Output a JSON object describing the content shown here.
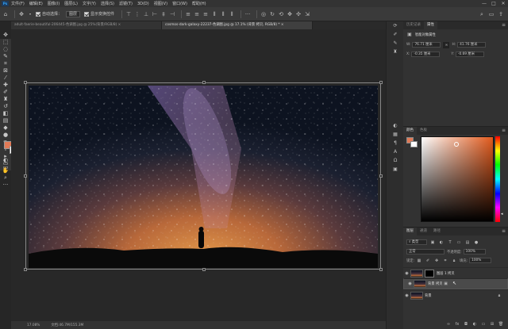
{
  "app": {
    "logo": "Ps"
  },
  "menu": [
    "文件(F)",
    "编辑(E)",
    "图像(I)",
    "图层(L)",
    "文字(Y)",
    "选择(S)",
    "滤镜(T)",
    "3D(D)",
    "视图(V)",
    "窗口(W)",
    "帮助(H)"
  ],
  "window_controls": [
    "—",
    "□",
    "✕"
  ],
  "options": {
    "auto_select_label": "自动选择：",
    "auto_select_value": "图层",
    "show_transform_label": "显示变换控件"
  },
  "tabs": [
    {
      "label": "adult-faerie-beautiful-206445-色调图.jpg @ 25%(背景/RGB/8) ×"
    },
    {
      "label": "cosmos-dark-galaxy-22237-色调图.jpg @ 17.1% (背景 拷贝, RGB/8) * ×"
    }
  ],
  "status": {
    "zoom": "17.08%",
    "doc": "文档:46.7M/155.3M"
  },
  "properties": {
    "tabs": [
      "历史记录",
      "属性"
    ],
    "title": "智能对象属性",
    "w_label": "W:",
    "w_value": "76.71 厘米",
    "h_label": "H:",
    "h_value": "41.76 厘米",
    "x_label": "X:",
    "x_value": "-0.35 厘米",
    "y_label": "Y:",
    "y_value": "-0.69 厘米"
  },
  "color_panel": {
    "tabs": [
      "颜色",
      "色板"
    ],
    "fg": "#e17a57",
    "bg": "#ffffff"
  },
  "layers_panel": {
    "tabs": [
      "图层",
      "通道",
      "路径"
    ],
    "filter_label": "类型",
    "blend_mode": "正常",
    "opacity_label": "不透明度:",
    "opacity_value": "100%",
    "lock_label": "锁定:",
    "fill_label": "填充:",
    "fill_value": "100%",
    "layers": [
      {
        "name": "图层 1 拷贝",
        "selected": false
      },
      {
        "name": "背景 拷贝",
        "selected": true
      },
      {
        "name": "背景",
        "selected": false
      }
    ]
  }
}
